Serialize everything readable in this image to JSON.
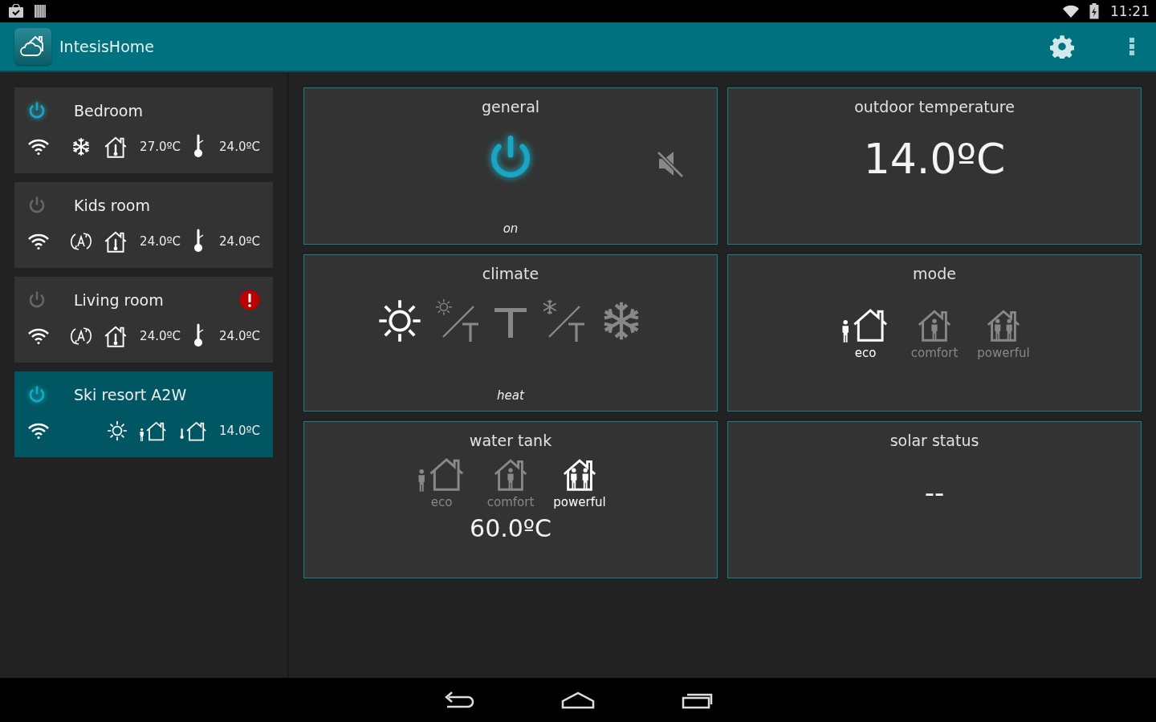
{
  "status_bar": {
    "time": "11:21"
  },
  "app_bar": {
    "title": "IntesisHome"
  },
  "devices": [
    {
      "name": "Bedroom",
      "on": true,
      "selected": false,
      "alert": false,
      "items": [
        {
          "kind": "wifi"
        },
        {
          "kind": "cool"
        },
        {
          "kind": "house-thermo"
        },
        {
          "kind": "text",
          "text": "27.0ºC"
        },
        {
          "kind": "thermo"
        },
        {
          "kind": "text",
          "text": "24.0ºC"
        }
      ]
    },
    {
      "name": "Kids room",
      "on": false,
      "selected": false,
      "alert": false,
      "items": [
        {
          "kind": "wifi"
        },
        {
          "kind": "auto"
        },
        {
          "kind": "house-thermo"
        },
        {
          "kind": "text",
          "text": "24.0ºC"
        },
        {
          "kind": "thermo"
        },
        {
          "kind": "text",
          "text": "24.0ºC"
        }
      ]
    },
    {
      "name": "Living room",
      "on": false,
      "selected": false,
      "alert": true,
      "items": [
        {
          "kind": "wifi"
        },
        {
          "kind": "auto"
        },
        {
          "kind": "house-thermo"
        },
        {
          "kind": "text",
          "text": "24.0ºC"
        },
        {
          "kind": "thermo"
        },
        {
          "kind": "text",
          "text": "24.0ºC"
        }
      ]
    },
    {
      "name": "Ski resort A2W",
      "on": true,
      "selected": true,
      "alert": false,
      "items": [
        {
          "kind": "wifi"
        },
        {
          "kind": "heat"
        },
        {
          "kind": "eco-house"
        },
        {
          "kind": "outdoor-house"
        },
        {
          "kind": "text",
          "text": "14.0ºC"
        }
      ]
    }
  ],
  "panels": [
    {
      "kind": "general",
      "title": "general",
      "on": true,
      "muted": true,
      "status": "on"
    },
    {
      "kind": "value",
      "title": "outdoor temperature",
      "value": "14.0ºC"
    },
    {
      "kind": "climate",
      "title": "climate",
      "status": "heat",
      "options": [
        {
          "kind": "heat",
          "selected": true
        },
        {
          "kind": "heat-auto",
          "selected": false
        },
        {
          "kind": "auto",
          "selected": false
        },
        {
          "kind": "cool-auto",
          "selected": false
        },
        {
          "kind": "cool",
          "selected": false
        }
      ]
    },
    {
      "kind": "modes",
      "title": "mode",
      "options": [
        {
          "kind": "eco",
          "label": "eco",
          "selected": true
        },
        {
          "kind": "comfort",
          "label": "comfort",
          "selected": false
        },
        {
          "kind": "powerful",
          "label": "powerful",
          "selected": false
        }
      ]
    },
    {
      "kind": "modes",
      "title": "water tank",
      "value": "60.0ºC",
      "options": [
        {
          "kind": "eco",
          "label": "eco",
          "selected": false
        },
        {
          "kind": "comfort",
          "label": "comfort",
          "selected": false
        },
        {
          "kind": "powerful",
          "label": "powerful",
          "selected": true
        }
      ]
    },
    {
      "kind": "dash",
      "title": "solar status",
      "value": "--"
    }
  ]
}
